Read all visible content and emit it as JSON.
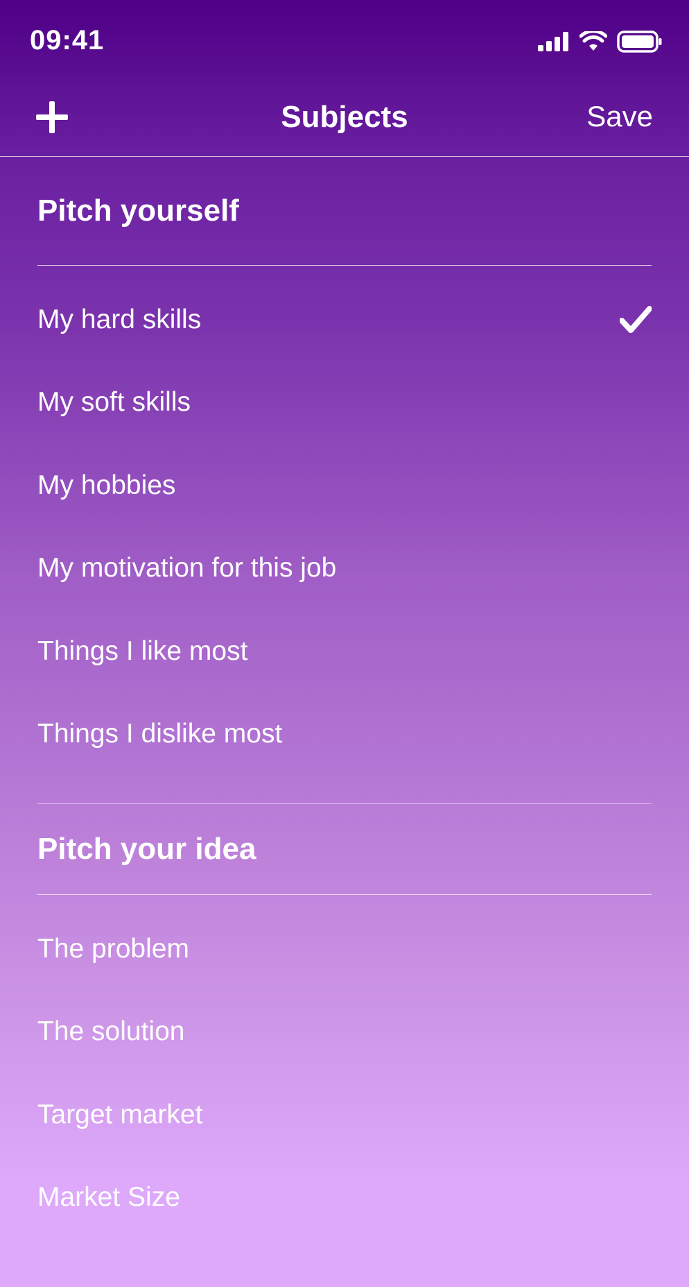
{
  "status_bar": {
    "time": "09:41",
    "icons": [
      "cellular-signal-icon",
      "wifi-icon",
      "battery-icon"
    ]
  },
  "nav": {
    "add_icon": "plus-icon",
    "title": "Subjects",
    "save_label": "Save"
  },
  "sections": [
    {
      "title": "Pitch yourself",
      "items": [
        {
          "label": "My hard skills",
          "selected": true
        },
        {
          "label": "My soft skills",
          "selected": false
        },
        {
          "label": "My hobbies",
          "selected": false
        },
        {
          "label": "My motivation for this job",
          "selected": false
        },
        {
          "label": "Things I like most",
          "selected": false
        },
        {
          "label": "Things I dislike most",
          "selected": false
        }
      ]
    },
    {
      "title": "Pitch your idea",
      "items": [
        {
          "label": "The problem",
          "selected": false
        },
        {
          "label": "The solution",
          "selected": false
        },
        {
          "label": "Target market",
          "selected": false
        },
        {
          "label": "Market Size",
          "selected": false
        }
      ]
    }
  ],
  "colors": {
    "gradient_top": "#4e0086",
    "gradient_bottom": "#dea9fb",
    "text": "#ffffff"
  }
}
